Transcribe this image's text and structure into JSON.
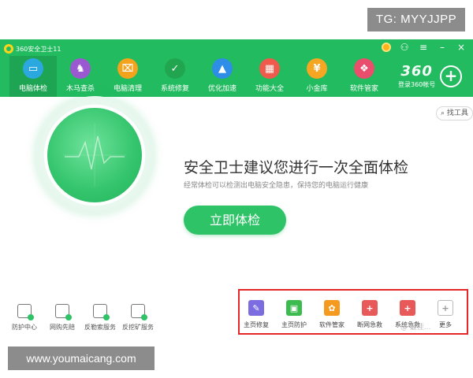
{
  "watermarks": {
    "tg": "TG: MYYJJPP",
    "site": "www.youmaicang.com",
    "weibo": "@ 最佳..."
  },
  "titlebar": {
    "app_title": "360安全卫士11",
    "bg_color": "#22bb5f",
    "controls": [
      "medal-icon",
      "shirt-icon",
      "menu-icon",
      "minimize-icon",
      "close-icon"
    ],
    "control_glyphs": {
      "shirt": "⚇",
      "menu": "≡",
      "minimize": "–",
      "close": "×"
    }
  },
  "tabs": [
    {
      "label": "电脑体检",
      "icon": "monitor-icon",
      "color": "#2ba8e0",
      "glyph": "▭",
      "active": true
    },
    {
      "label": "木马查杀",
      "icon": "horse-icon",
      "color": "#9b59d1",
      "glyph": "♞",
      "active": false
    },
    {
      "label": "电脑清理",
      "icon": "broom-icon",
      "color": "#f4a31d",
      "glyph": "⌧",
      "active": false
    },
    {
      "label": "系统修复",
      "icon": "shield-icon",
      "color": "#21a64f",
      "glyph": "✓",
      "active": false
    },
    {
      "label": "优化加速",
      "icon": "rocket-icon",
      "color": "#2e8de6",
      "glyph": "▲",
      "active": false
    },
    {
      "label": "功能大全",
      "icon": "grid-icon",
      "color": "#ef5a4c",
      "glyph": "▦",
      "active": false
    },
    {
      "label": "小金库",
      "icon": "coin-icon",
      "color": "#f5a623",
      "glyph": "¥",
      "active": false
    },
    {
      "label": "软件管家",
      "icon": "software-icon",
      "color": "#e94f6c",
      "glyph": "❖",
      "active": false
    }
  ],
  "account": {
    "brand": "360",
    "login": "登录360帐号"
  },
  "find_tool": "找工具",
  "hero": {
    "headline": "安全卫士建议您进行一次全面体检",
    "subline": "经常体检可以检测出电脑安全隐患，保持您的电脑运行健康",
    "button": "立即体检",
    "button_color": "#2fc368"
  },
  "services": [
    {
      "label": "防护中心",
      "icon": "shield-check-icon"
    },
    {
      "label": "网购先赔",
      "icon": "cart-icon"
    },
    {
      "label": "反勒索服务",
      "icon": "file-lock-icon"
    },
    {
      "label": "反挖矿服务",
      "icon": "mining-shield-icon"
    }
  ],
  "tools": [
    {
      "label": "主页修复",
      "icon": "wrench-icon",
      "color": "#7b6ce0",
      "glyph": "✎"
    },
    {
      "label": "主页防护",
      "icon": "lock-icon",
      "color": "#3dbb4f",
      "glyph": "▣"
    },
    {
      "label": "软件管家",
      "icon": "pinwheel-icon",
      "color": "#f39a1f",
      "glyph": "✿"
    },
    {
      "label": "断网急救",
      "icon": "first-aid-icon",
      "color": "#e85a5a",
      "glyph": "+"
    },
    {
      "label": "系统急救",
      "icon": "medkit-icon",
      "color": "#e85a5a",
      "glyph": "+"
    },
    {
      "label": "更多",
      "icon": "plus-icon",
      "color": "#bbbbbb",
      "glyph": "+"
    }
  ],
  "highlight_color": "#e6272a"
}
